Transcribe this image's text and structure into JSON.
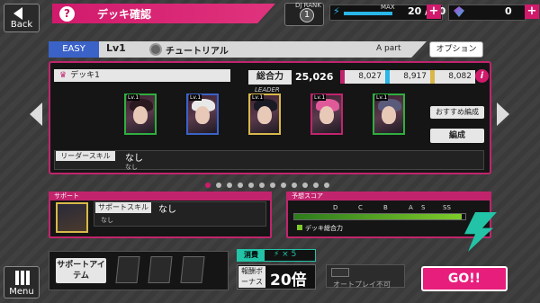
{
  "header": {
    "back_label": "Back",
    "help_label": "?",
    "title": "デッキ確認"
  },
  "rank": {
    "label": "DJ RANK",
    "value": "1"
  },
  "stamina": {
    "max_label": "MAX",
    "value": "20 / 20",
    "plus": "+",
    "fill_fraction": 0.5
  },
  "gems": {
    "value": "0",
    "plus": "+"
  },
  "live": {
    "difficulty": "EASY",
    "level": "Lv1",
    "song": "チュートリアル",
    "part": "A part",
    "options_label": "オプション"
  },
  "deck": {
    "name": "デッキ1",
    "power_label": "総合力",
    "power": "25,026",
    "attributes": [
      {
        "value": "8,027",
        "color": "#c1246d"
      },
      {
        "value": "8,917",
        "color": "#29b6e8"
      },
      {
        "value": "8,082",
        "color": "#d8b84a"
      }
    ],
    "info": "i",
    "leader_label": "LEADER",
    "cards": [
      {
        "level": "Lv.1",
        "frame": "#2fae3e",
        "hair": "#2a1a1f"
      },
      {
        "level": "Lv.1",
        "frame": "#3b62c7",
        "hair": "#e8e8e8"
      },
      {
        "level": "Lv.1",
        "frame": "#d8b84a",
        "hair": "#1a1a24"
      },
      {
        "level": "Lv.1",
        "frame": "#c1246d",
        "hair": "#e05a9a"
      },
      {
        "level": "Lv.1",
        "frame": "#2fae3e",
        "hair": "#5a5a7a"
      }
    ],
    "recommend_label": "おすすめ編成",
    "edit_label": "編成",
    "leader_skill_label": "リーダースキル",
    "leader_skill_name": "なし",
    "leader_skill_desc": "なし"
  },
  "pager": {
    "count": 12,
    "active": 0
  },
  "support": {
    "header": "サポート",
    "skill_label": "サポートスキル",
    "skill_name": "なし",
    "skill_desc": "なし"
  },
  "score": {
    "header": "予想スコア",
    "ranks": [
      "D",
      "C",
      "B",
      "A",
      "S",
      "SS"
    ],
    "legend": "デッキ総合力",
    "fill_fraction": 0.98
  },
  "bottom": {
    "menu_label": "Menu",
    "support_item_label": "サポートアイテム",
    "consume_label": "消費",
    "consume_value": "⚡ × 5",
    "bonus_label": "報酬ボーナス",
    "bonus_value": "20倍",
    "auto_label": "オートプレイ不可",
    "go_label": "GO!!"
  }
}
